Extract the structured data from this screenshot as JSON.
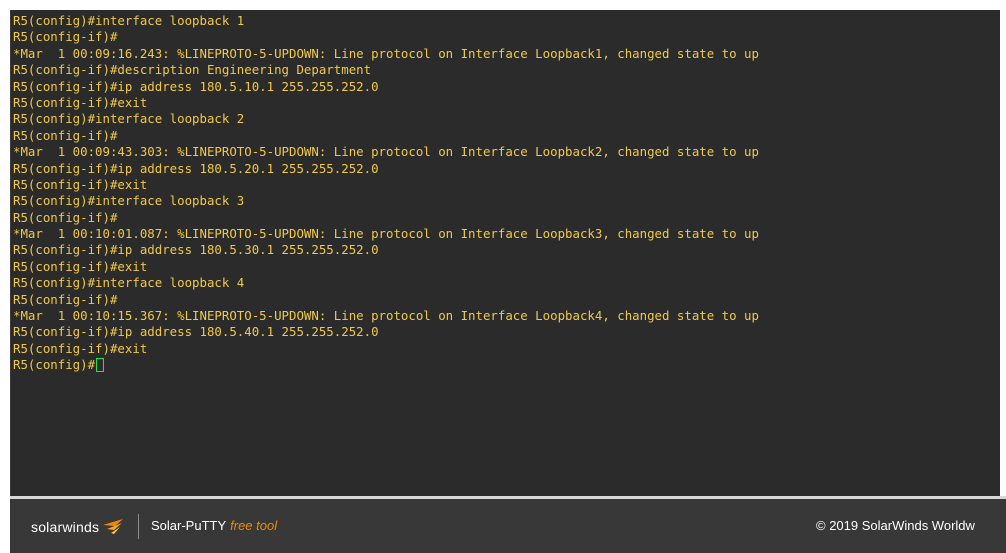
{
  "terminal": {
    "lines": [
      "R5(config)#interface loopback 1",
      "R5(config-if)#",
      "*Mar  1 00:09:16.243: %LINEPROTO-5-UPDOWN: Line protocol on Interface Loopback1, changed state to up",
      "R5(config-if)#description Engineering Department",
      "R5(config-if)#ip address 180.5.10.1 255.255.252.0",
      "R5(config-if)#exit",
      "R5(config)#interface loopback 2",
      "R5(config-if)#",
      "*Mar  1 00:09:43.303: %LINEPROTO-5-UPDOWN: Line protocol on Interface Loopback2, changed state to up",
      "R5(config-if)#ip address 180.5.20.1 255.255.252.0",
      "R5(config-if)#exit",
      "R5(config)#interface loopback 3",
      "R5(config-if)#",
      "*Mar  1 00:10:01.087: %LINEPROTO-5-UPDOWN: Line protocol on Interface Loopback3, changed state to up",
      "R5(config-if)#ip address 180.5.30.1 255.255.252.0",
      "R5(config-if)#exit",
      "R5(config)#interface loopback 4",
      "R5(config-if)#",
      "*Mar  1 00:10:15.367: %LINEPROTO-5-UPDOWN: Line protocol on Interface Loopback4, changed state to up",
      "R5(config-if)#ip address 180.5.40.1 255.255.252.0",
      "R5(config-if)#exit"
    ],
    "prompt": "R5(config)#"
  },
  "footer": {
    "brand": "solarwinds",
    "product_name": "Solar-PuTTY",
    "product_tag": "free tool",
    "copyright": "© 2019 SolarWinds Worldw"
  },
  "colors": {
    "terminal_text": "#f0c84a",
    "terminal_background": "#2b2b2b",
    "cursor": "#22e14f",
    "footer_background": "#383838",
    "brand_accent": "#f18a00"
  },
  "icons": {
    "brand_logo": "solarwinds-bird-icon",
    "cursor": "block-cursor"
  }
}
